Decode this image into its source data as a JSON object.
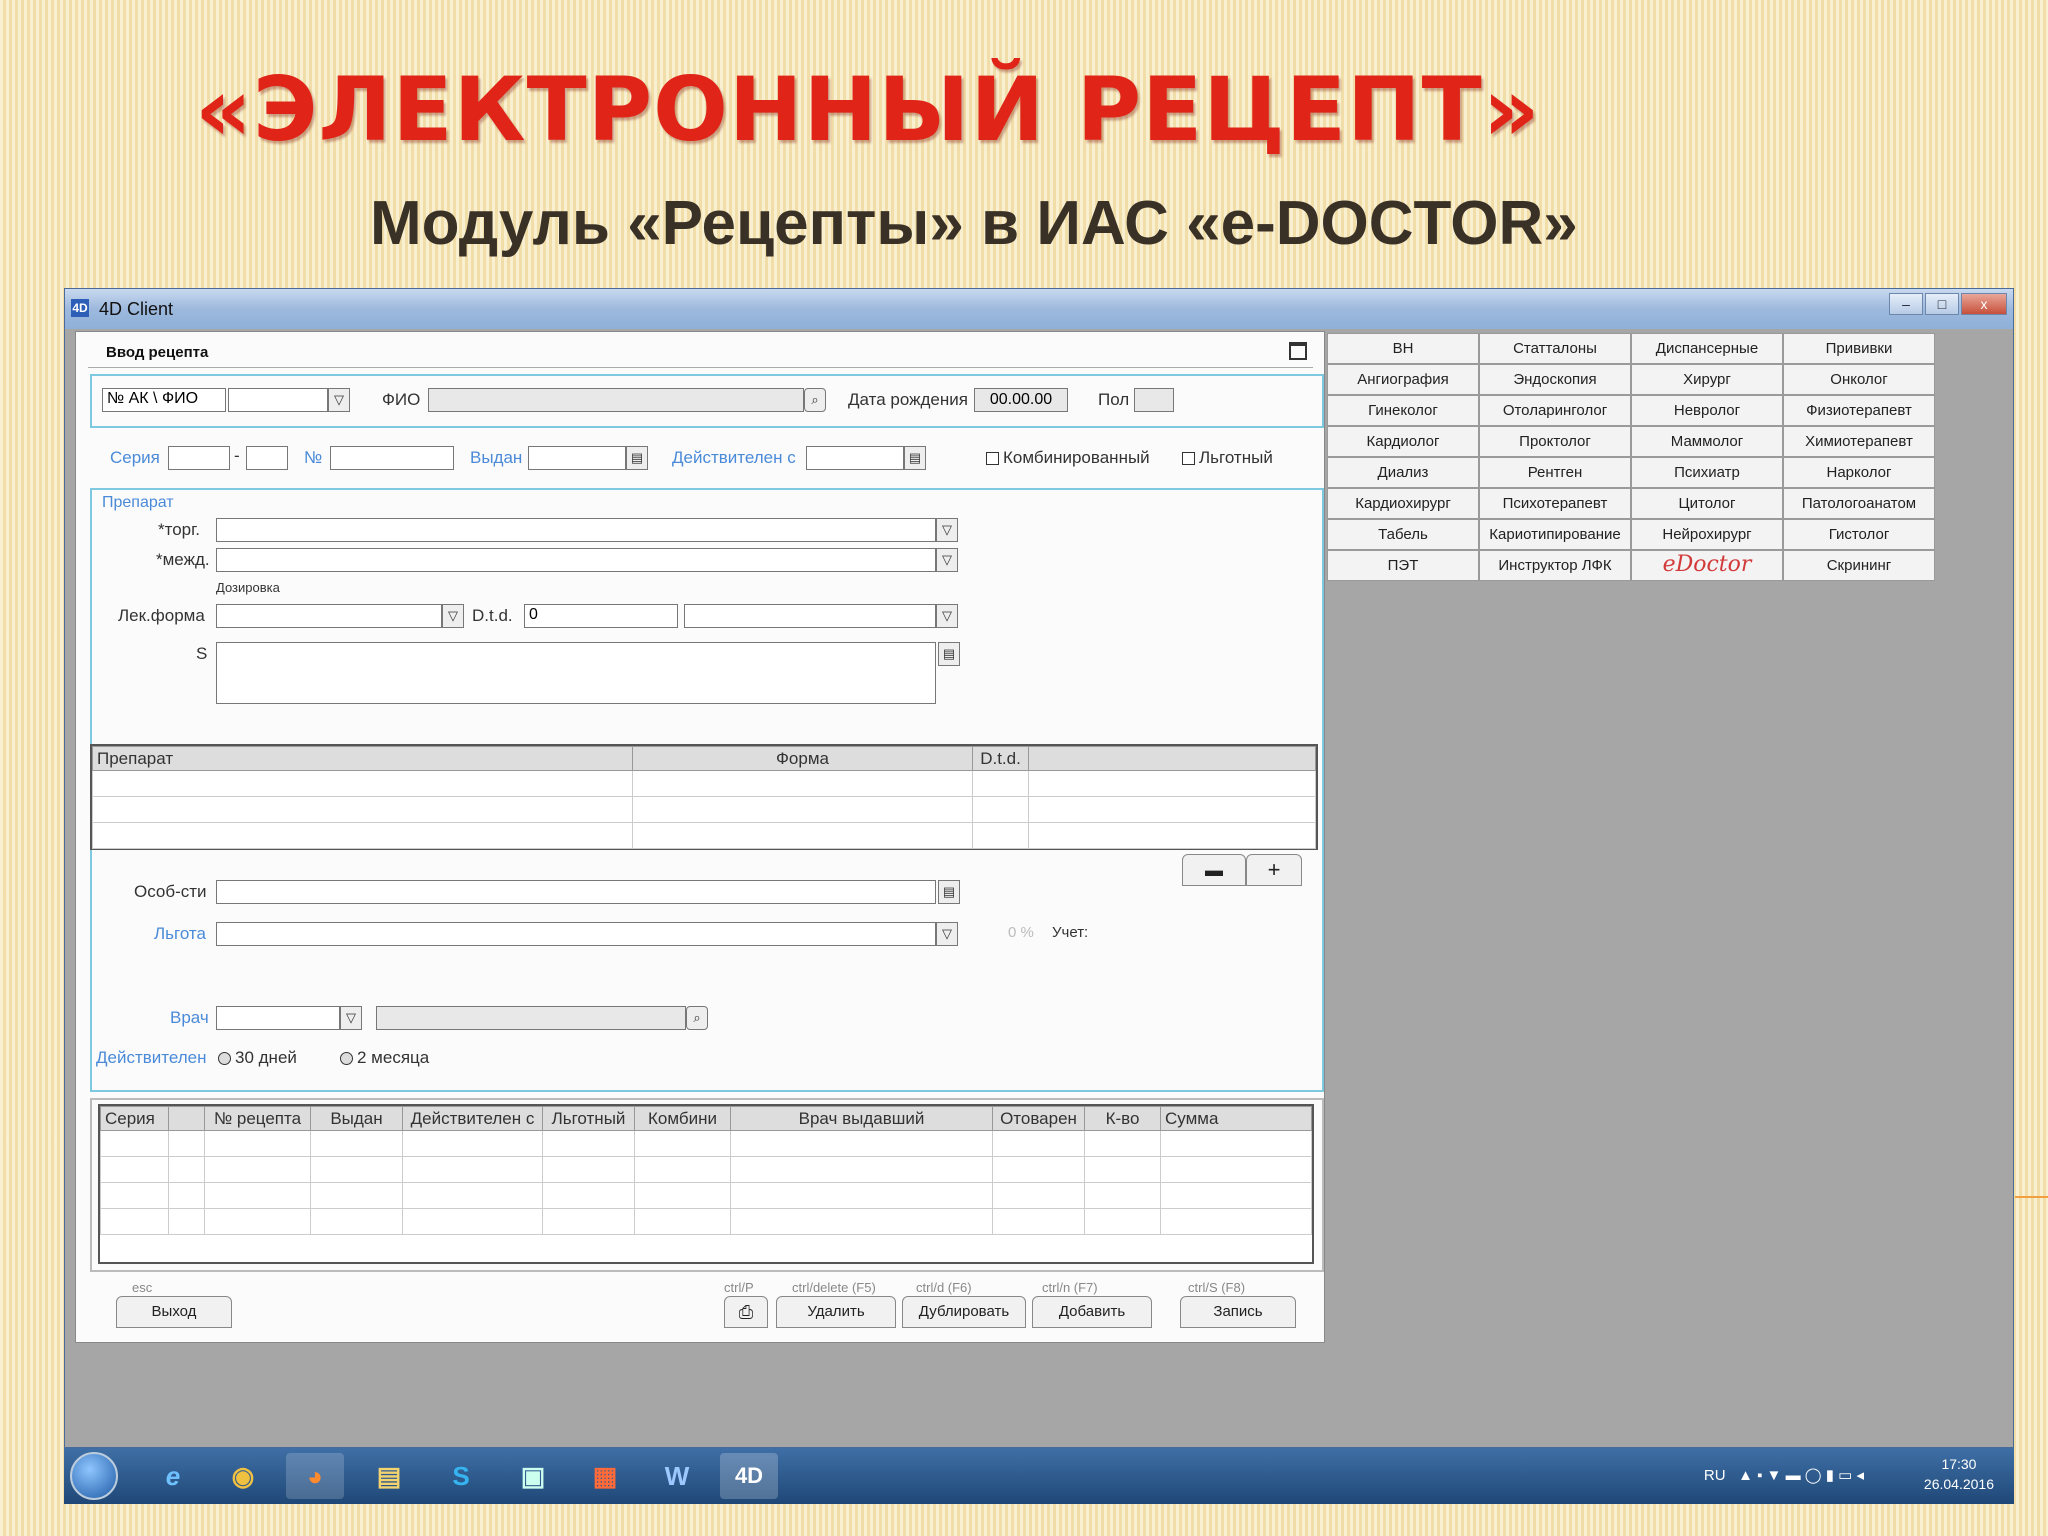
{
  "slide": {
    "title": "«ЭЛЕКТРОННЫЙ РЕЦЕПТ»",
    "subtitle": "Модуль «Рецепты» в ИАС «е-DOCTOR»"
  },
  "window": {
    "title": "4D Client",
    "icon": "4D",
    "buttons": {
      "min": "–",
      "max": "□",
      "close": "x"
    }
  },
  "form": {
    "tab_title": "Ввод рецепта",
    "row1": {
      "selector": "№ АК \\ ФИО",
      "fio_label": "ФИО",
      "dob_label": "Дата рождения",
      "dob_value": "00.00.00",
      "sex_label": "Пол"
    },
    "row2": {
      "series_label": "Серия",
      "num_label": "№",
      "issued_label": "Выдан",
      "valid_from_label": "Действителен с",
      "combined_label": "Комбинированный",
      "preferential_label": "Льготный"
    },
    "drug": {
      "section_label": "Препарат",
      "trade_label": "*торг.",
      "intl_label": "*межд.",
      "dosage_label": "Дозировка",
      "form_label": "Лек.форма",
      "dtd_label": "D.t.d.",
      "dtd_value": "0",
      "s_label": "S"
    },
    "drug_table": {
      "headers": [
        "Препарат",
        "Форма",
        "D.t.d.",
        ""
      ]
    },
    "features_label": "Особ-сти",
    "benefit_label": "Льгота",
    "benefit_percent": "0 %",
    "account_label": "Учет:",
    "doctor_label": "Врач",
    "valid_label": "Действителен",
    "valid_30": "30 дней",
    "valid_2m": "2 месяца",
    "rx_table": {
      "headers": [
        "Серия",
        "",
        "№ рецепта",
        "Выдан",
        "Действителен с",
        "Льготный",
        "Комбини",
        "Врач выдавший",
        "Отоварен",
        "К-во",
        "Сумма"
      ]
    },
    "footer": {
      "exit_hint": "esc",
      "exit": "Выход",
      "print_hint": "ctrl/P",
      "delete_hint": "ctrl/delete (F5)",
      "delete": "Удалить",
      "dup_hint": "ctrl/d (F6)",
      "dup": "Дублировать",
      "add_hint": "ctrl/n (F7)",
      "add": "Добавить",
      "save_hint": "ctrl/S (F8)",
      "save": "Запись"
    }
  },
  "specialists": [
    [
      "ВН",
      "Статталоны",
      "Диспансерные",
      "Прививки"
    ],
    [
      "Ангиография",
      "Эндоскопия",
      "Хирург",
      "Онколог"
    ],
    [
      "Гинеколог",
      "Отоларинголог",
      "Невролог",
      "Физиотерапевт"
    ],
    [
      "Кардиолог",
      "Проктолог",
      "Маммолог",
      "Химиотерапевт"
    ],
    [
      "Диализ",
      "Рентген",
      "Психиатр",
      "Нарколог"
    ],
    [
      "Кардиохирург",
      "Психотерапевт",
      "Цитолог",
      "Патологоанатом"
    ],
    [
      "Табель",
      "Кариотипирование",
      "Нейрохирург",
      "Гистолог"
    ],
    [
      "ПЭТ",
      "Инструктор ЛФК",
      "eDoctor",
      "Скрининг"
    ]
  ],
  "taskbar": {
    "apps": [
      "e",
      "◉",
      "◕",
      "▤",
      "S",
      "▣",
      "▦",
      "W",
      "4D"
    ],
    "tray_lang": "RU",
    "tray_icons": "▲ ▪ ▼ ▬ ◯ ▮ ▭ ◂",
    "time": "17:30",
    "date": "26.04.2016"
  },
  "colors": {
    "title_red": "#e02418",
    "label_blue": "#4a8ad8",
    "section_border": "#7ec8e0"
  }
}
